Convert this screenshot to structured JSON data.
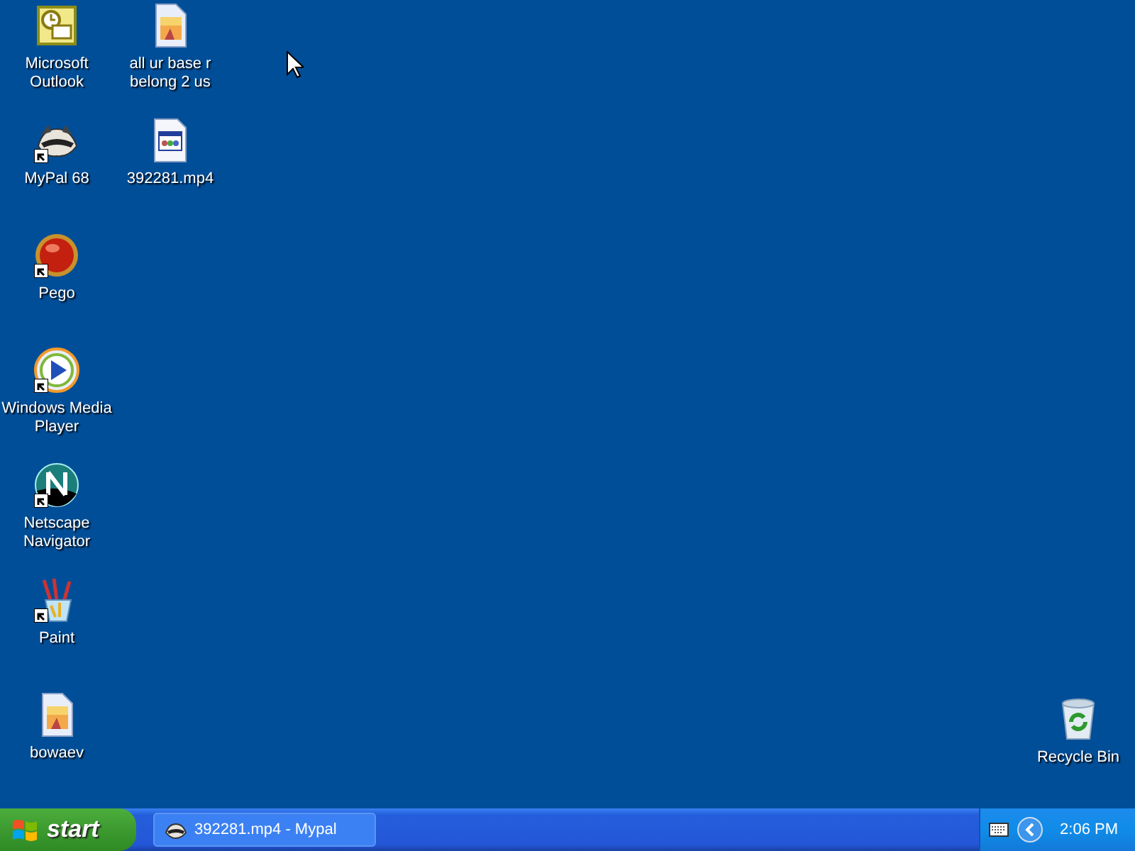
{
  "desktop": {
    "columns": [
      {
        "icons": [
          {
            "kind": "outlook",
            "label": "Microsoft Outlook",
            "shortcut": false
          },
          {
            "kind": "raccoon",
            "label": "MyPal 68",
            "shortcut": true
          },
          {
            "kind": "ball",
            "label": "Pego",
            "shortcut": true
          },
          {
            "kind": "media",
            "label": "Windows Media Player",
            "shortcut": true
          },
          {
            "kind": "netscape",
            "label": "Netscape Navigator",
            "shortcut": true
          },
          {
            "kind": "paint",
            "label": "Paint",
            "shortcut": true
          },
          {
            "kind": "image",
            "label": "bowaev",
            "shortcut": false
          }
        ]
      },
      {
        "icons": [
          {
            "kind": "image",
            "label": "all ur base r belong 2 us",
            "shortcut": false
          },
          {
            "kind": "video",
            "label": "392281.mp4",
            "shortcut": false
          }
        ]
      }
    ],
    "right_icons": [
      {
        "kind": "recycle",
        "label": "Recycle Bin",
        "shortcut": false
      }
    ]
  },
  "taskbar": {
    "start": "start",
    "tasks": [
      {
        "label": "392281.mp4 - Mypal",
        "selected": false
      }
    ],
    "clock": "2:06 PM"
  }
}
